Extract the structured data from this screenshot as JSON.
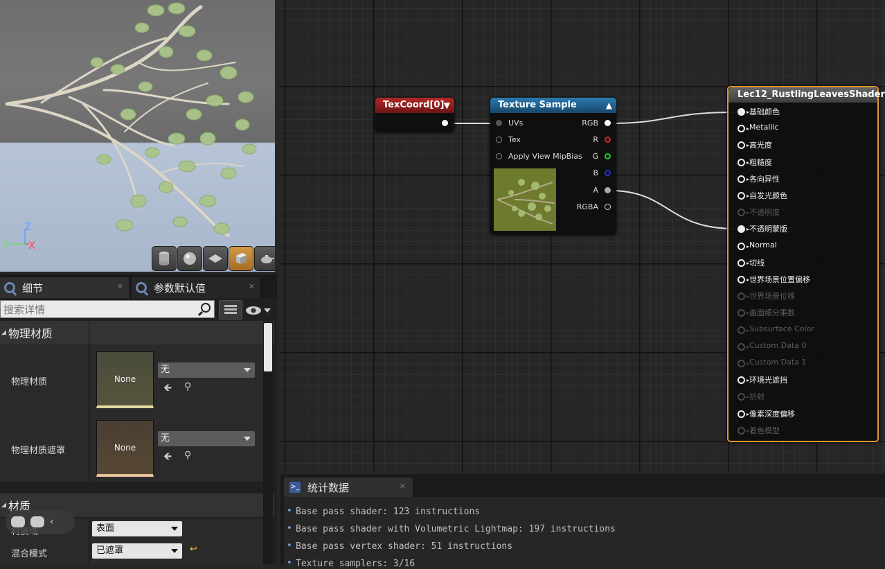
{
  "viewport": {
    "axes": {
      "z": "Z",
      "y": "Y",
      "x": "X"
    },
    "buttons": [
      "cylinder-icon",
      "sphere-icon",
      "plane-icon",
      "cube-icon",
      "teapot-icon"
    ],
    "active_button": "cube-icon"
  },
  "details": {
    "tabs": [
      {
        "label": "细节"
      },
      {
        "label": "参数默认值"
      }
    ],
    "search_placeholder": "搜索详情",
    "sections": {
      "physical": "物理材质",
      "material": "材质"
    },
    "properties": [
      {
        "label": "物理材质",
        "thumb": "None",
        "value": "无"
      },
      {
        "label": "物理材质遮罩",
        "thumb": "None",
        "value": "无"
      }
    ],
    "material_rows": [
      {
        "label": "材质域",
        "value": "表面"
      },
      {
        "label": "混合模式",
        "value": "已遮罩"
      }
    ]
  },
  "graph": {
    "texcoord": {
      "title": "TexCoord[0]"
    },
    "texture_sample": {
      "title": "Texture Sample",
      "inputs": [
        "UVs",
        "Tex",
        "Apply View MipBias"
      ],
      "outputs": [
        "RGB",
        "R",
        "G",
        "B",
        "A",
        "RGBA"
      ]
    },
    "result": {
      "title": "Lec12_RustlingLeavesShader",
      "pins": [
        {
          "label": "基础颜色",
          "state": "connected"
        },
        {
          "label": "Metallic",
          "state": "open"
        },
        {
          "label": "高光度",
          "state": "open"
        },
        {
          "label": "粗糙度",
          "state": "open"
        },
        {
          "label": "各向异性",
          "state": "open"
        },
        {
          "label": "自发光颜色",
          "state": "open"
        },
        {
          "label": "不透明度",
          "state": "disabled"
        },
        {
          "label": "不透明蒙版",
          "state": "connected"
        },
        {
          "label": "Normal",
          "state": "open"
        },
        {
          "label": "切线",
          "state": "open"
        },
        {
          "label": "世界场景位置偏移",
          "state": "open"
        },
        {
          "label": "世界场景位移",
          "state": "disabled"
        },
        {
          "label": "曲面细分乘数",
          "state": "disabled"
        },
        {
          "label": "Subsurface Color",
          "state": "disabled"
        },
        {
          "label": "Custom Data 0",
          "state": "disabled"
        },
        {
          "label": "Custom Data 1",
          "state": "disabled"
        },
        {
          "label": "环境光遮挡",
          "state": "open"
        },
        {
          "label": "折射",
          "state": "disabled"
        },
        {
          "label": "像素深度偏移",
          "state": "open"
        },
        {
          "label": "着色模型",
          "state": "disabled"
        }
      ]
    },
    "colors": {
      "texcoord_header": "#8e1d1d",
      "texture_header": "#1f5a80",
      "result_border": "#e0952a"
    }
  },
  "stats": {
    "tab_label": "统计数据",
    "lines": [
      "Base pass shader: 123 instructions",
      "Base pass shader with Volumetric Lightmap: 197 instructions",
      "Base pass vertex shader: 51 instructions",
      "Texture samplers: 3/16"
    ]
  }
}
